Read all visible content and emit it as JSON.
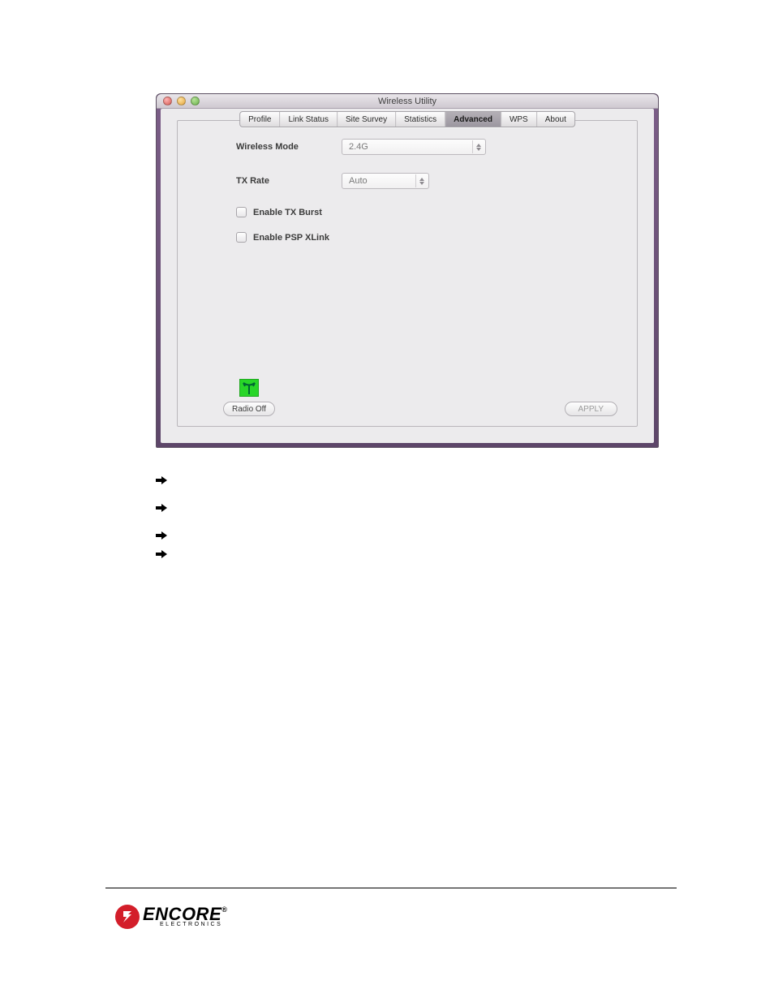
{
  "window": {
    "title": "Wireless Utility",
    "tabs": [
      "Profile",
      "Link Status",
      "Site Survey",
      "Statistics",
      "Advanced",
      "WPS",
      "About"
    ],
    "selected_tab": "Advanced",
    "wireless_mode": {
      "label": "Wireless Mode",
      "value": "2.4G"
    },
    "tx_rate": {
      "label": "TX Rate",
      "value": "Auto"
    },
    "enable_tx_burst": {
      "label": "Enable TX Burst",
      "checked": false
    },
    "enable_psp_xlink": {
      "label": "Enable PSP XLink",
      "checked": false
    },
    "radio_off": "Radio Off",
    "apply": "APPLY"
  },
  "logo": {
    "brand": "ENCORE",
    "sub": "ELECTRONICS"
  }
}
